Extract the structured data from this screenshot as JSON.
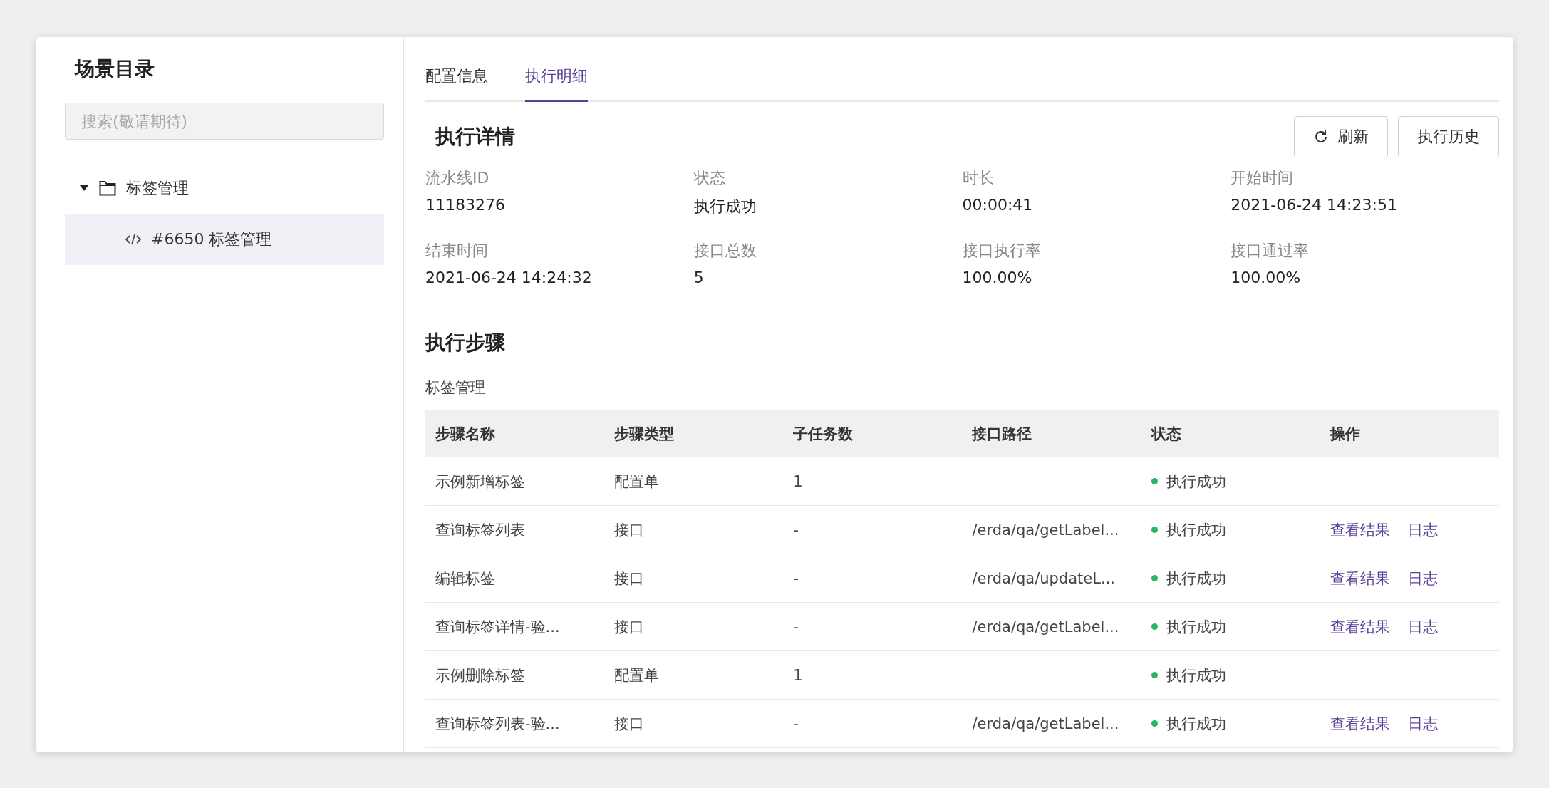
{
  "sidebar": {
    "title": "场景目录",
    "search": {
      "placeholder": "搜索(敬请期待)"
    },
    "tree": [
      {
        "label": "标签管理",
        "expanded": true,
        "selected": false,
        "kind": "folder",
        "children": [
          {
            "label": "#6650 标签管理",
            "selected": true,
            "kind": "scene"
          }
        ]
      }
    ]
  },
  "tabs": [
    {
      "label": "配置信息",
      "selected": false
    },
    {
      "label": "执行明细",
      "selected": true
    }
  ],
  "detail": {
    "title": "执行详情",
    "buttons": [
      {
        "label": "刷新",
        "kind": "refresh"
      },
      {
        "label": "执行历史",
        "kind": "plain"
      }
    ],
    "fields": [
      {
        "label": "流水线ID",
        "value": "11183276"
      },
      {
        "label": "状态",
        "value": "执行成功"
      },
      {
        "label": "时长",
        "value": "00:00:41"
      },
      {
        "label": "开始时间",
        "value": "2021-06-24 14:23:51"
      },
      {
        "label": "结束时间",
        "value": "2021-06-24 14:24:32"
      },
      {
        "label": "接口总数",
        "value": "5"
      },
      {
        "label": "接口执行率",
        "value": "100.00%"
      },
      {
        "label": "接口通过率",
        "value": "100.00%"
      }
    ]
  },
  "steps": {
    "title": "执行步骤",
    "group": "标签管理",
    "table": {
      "columns": [
        "步骤名称",
        "步骤类型",
        "子任务数",
        "接口路径",
        "状态",
        "操作"
      ],
      "rows": [
        {
          "name": "示例新增标签",
          "type": "配置单",
          "subtasks": "1",
          "path": "",
          "status": "执行成功",
          "actions": []
        },
        {
          "name": "查询标签列表",
          "type": "接口",
          "subtasks": "-",
          "path": "/erda/qa/getLabel...",
          "status": "执行成功",
          "actions": [
            "查看结果",
            "日志"
          ]
        },
        {
          "name": "编辑标签",
          "type": "接口",
          "subtasks": "-",
          "path": "/erda/qa/updateL...",
          "status": "执行成功",
          "actions": [
            "查看结果",
            "日志"
          ]
        },
        {
          "name": "查询标签详情-验...",
          "type": "接口",
          "subtasks": "-",
          "path": "/erda/qa/getLabel...",
          "status": "执行成功",
          "actions": [
            "查看结果",
            "日志"
          ]
        },
        {
          "name": "示例删除标签",
          "type": "配置单",
          "subtasks": "1",
          "path": "",
          "status": "执行成功",
          "actions": []
        },
        {
          "name": "查询标签列表-验...",
          "type": "接口",
          "subtasks": "-",
          "path": "/erda/qa/getLabel...",
          "status": "执行成功",
          "actions": [
            "查看结果",
            "日志"
          ]
        }
      ]
    }
  }
}
